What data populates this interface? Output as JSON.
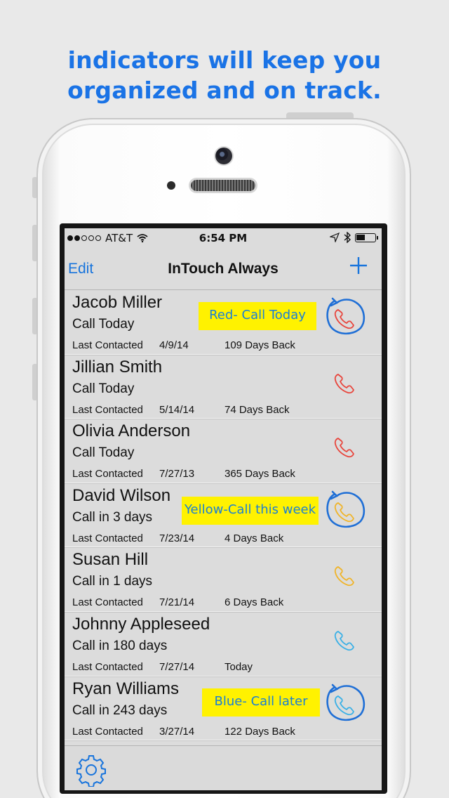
{
  "headline": {
    "line1": "indicators will keep you",
    "line2": "organized and on track."
  },
  "status_bar": {
    "carrier": "AT&T",
    "time": "6:54 PM",
    "signal_filled": 2,
    "signal_total": 5
  },
  "nav": {
    "edit_label": "Edit",
    "title": "InTouch Always",
    "add_icon": "plus-icon"
  },
  "contacts": [
    {
      "name": "Jacob Miller",
      "status": "Call Today",
      "last_label": "Last Contacted",
      "last_date": "4/9/14",
      "days": "109 Days Back",
      "color": "#e8453c"
    },
    {
      "name": "Jillian Smith",
      "status": "Call Today",
      "last_label": "Last Contacted",
      "last_date": "5/14/14",
      "days": "74 Days Back",
      "color": "#e8453c"
    },
    {
      "name": "Olivia Anderson",
      "status": "Call Today",
      "last_label": "Last Contacted",
      "last_date": "7/27/13",
      "days": "365 Days Back",
      "color": "#e8453c"
    },
    {
      "name": "David Wilson",
      "status": "Call in 3 days",
      "last_label": "Last Contacted",
      "last_date": "7/23/14",
      "days": "4 Days Back",
      "color": "#f0b429"
    },
    {
      "name": "Susan Hill",
      "status": "Call in 1 days",
      "last_label": "Last Contacted",
      "last_date": "7/21/14",
      "days": "6 Days Back",
      "color": "#f0b429"
    },
    {
      "name": "Johnny Appleseed",
      "status": "Call in 180 days",
      "last_label": "Last Contacted",
      "last_date": "7/27/14",
      "days": "Today",
      "color": "#3ab0e6"
    },
    {
      "name": "Ryan Williams",
      "status": "Call in 243 days",
      "last_label": "Last Contacted",
      "last_date": "3/27/14",
      "days": "122 Days Back",
      "color": "#3ab0e6"
    }
  ],
  "annotations": [
    {
      "text": "Red- Call Today"
    },
    {
      "text": "Yellow-Call this week"
    },
    {
      "text": "Blue- Call later"
    }
  ],
  "colors": {
    "accent": "#1874dc",
    "headline": "#1a73e6",
    "note_bg": "#fff200",
    "note_text": "#1a7fd6",
    "red": "#e8453c",
    "yellow": "#f0b429",
    "blue": "#3ab0e6"
  },
  "toolbar": {
    "settings_icon": "gear-icon"
  }
}
